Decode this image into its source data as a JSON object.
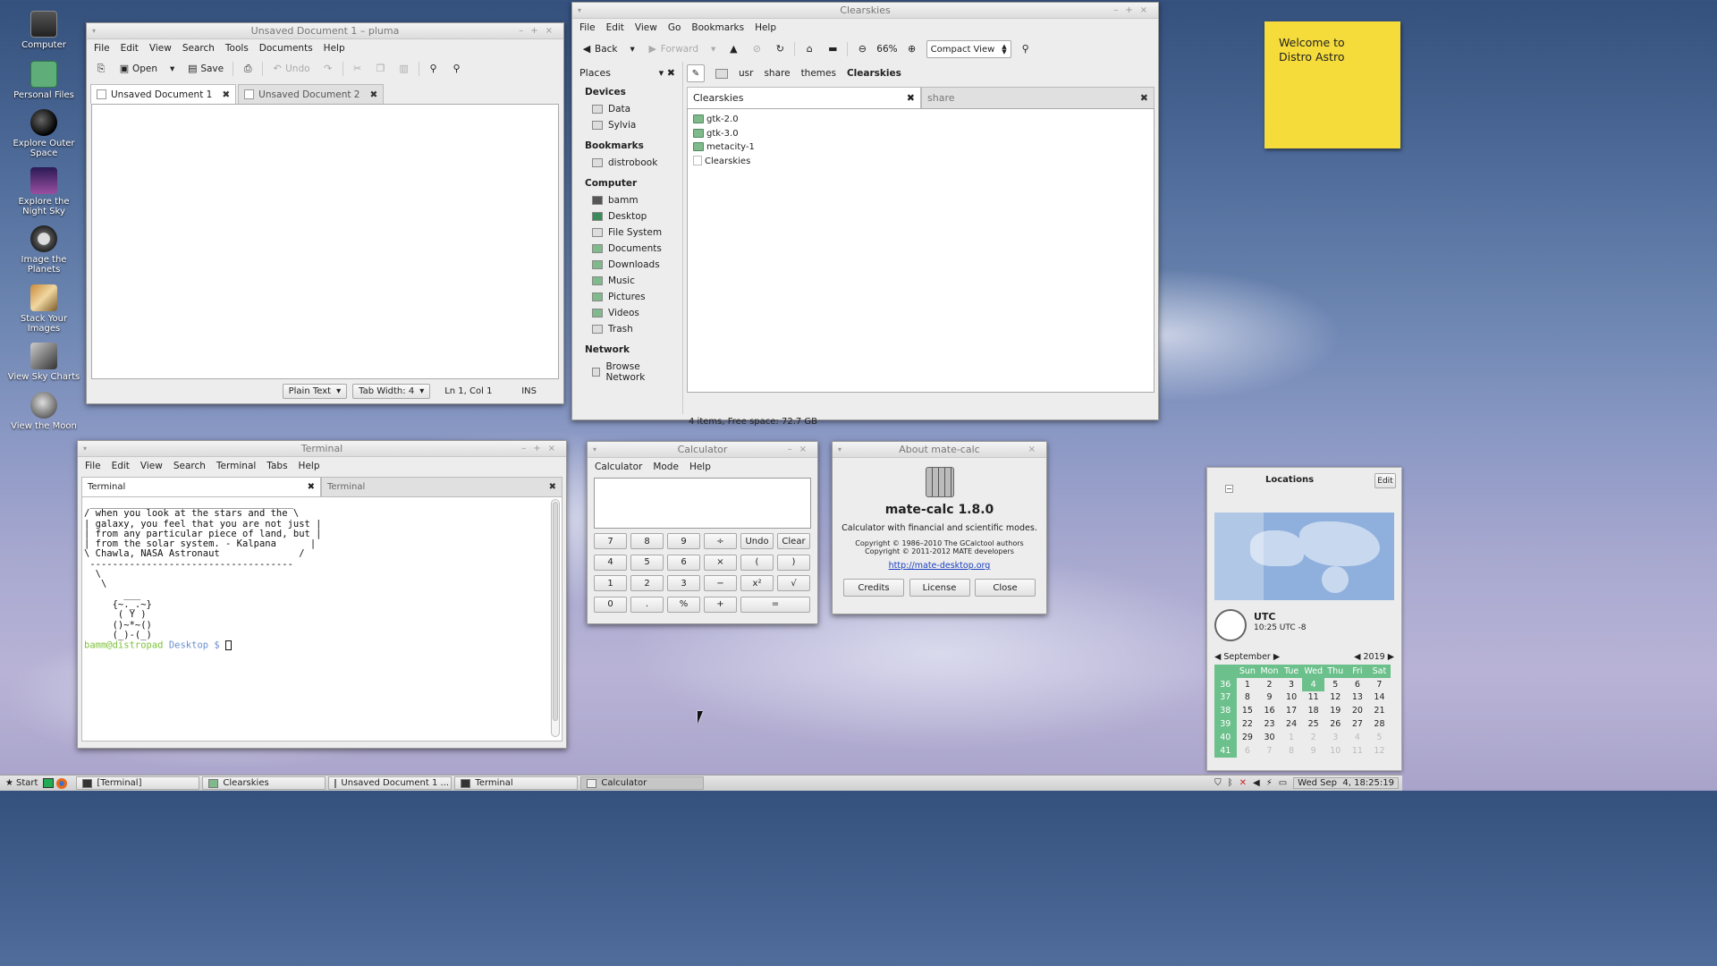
{
  "desktop_icons": [
    {
      "label": "Computer"
    },
    {
      "label": "Personal Files"
    },
    {
      "label": "Explore Outer Space"
    },
    {
      "label": "Explore the Night Sky"
    },
    {
      "label": "Image the Planets"
    },
    {
      "label": "Stack Your Images"
    },
    {
      "label": "View Sky Charts"
    },
    {
      "label": "View the Moon"
    }
  ],
  "sticky": {
    "text": "Welcome to Distro Astro"
  },
  "pluma": {
    "title": "Unsaved Document 1 – pluma",
    "menu": [
      "File",
      "Edit",
      "View",
      "Search",
      "Tools",
      "Documents",
      "Help"
    ],
    "toolbar": {
      "open": "Open",
      "save": "Save",
      "undo": "Undo"
    },
    "tabs": [
      "Unsaved Document 1",
      "Unsaved Document 2"
    ],
    "status": {
      "lang": "Plain Text",
      "tabwidth": "Tab Width:  4",
      "pos": "Ln 1, Col 1",
      "mode": "INS"
    }
  },
  "caja": {
    "title": "Clearskies",
    "menu": [
      "File",
      "Edit",
      "View",
      "Go",
      "Bookmarks",
      "Help"
    ],
    "toolbar": {
      "back": "Back",
      "forward": "Forward",
      "zoom": "66%",
      "view": "Compact View"
    },
    "places_label": "Places",
    "path": [
      "usr",
      "share",
      "themes",
      "Clearskies"
    ],
    "sections": [
      {
        "title": "Devices",
        "items": [
          "Data",
          "Sylvia"
        ]
      },
      {
        "title": "Bookmarks",
        "items": [
          "distrobook"
        ]
      },
      {
        "title": "Computer",
        "items": [
          "bamm",
          "Desktop",
          "File System",
          "Documents",
          "Downloads",
          "Music",
          "Pictures",
          "Videos",
          "Trash"
        ]
      },
      {
        "title": "Network",
        "items": [
          "Browse Network"
        ]
      }
    ],
    "tabs": [
      "Clearskies",
      "share"
    ],
    "files": [
      "gtk-2.0",
      "gtk-3.0",
      "metacity-1",
      "Clearskies"
    ],
    "status": "4 items, Free space: 72.7 GB"
  },
  "terminal": {
    "title": "Terminal",
    "menu": [
      "File",
      "Edit",
      "View",
      "Search",
      "Terminal",
      "Tabs",
      "Help"
    ],
    "tabs": [
      "Terminal",
      "Terminal"
    ],
    "lines": [
      " ____________________________________",
      "/ when you look at the stars and the \\",
      "| galaxy, you feel that you are not just |",
      "| from any particular piece of land, but |",
      "| from the solar system. - Kalpana      |",
      "\\ Chawla, NASA Astronaut              /",
      " ------------------------------------",
      "  \\",
      "   \\",
      "       ___",
      "     {~._.~}",
      "      ( Y )",
      "     ()~*~()",
      "     (_)-(_)"
    ],
    "prompt_user": "bamm@distropad",
    "prompt_dir": "Desktop $"
  },
  "calculator": {
    "title": "Calculator",
    "menu": [
      "Calculator",
      "Mode",
      "Help"
    ],
    "buttons": [
      [
        "7",
        "8",
        "9",
        "÷",
        "Undo",
        "Clear"
      ],
      [
        "4",
        "5",
        "6",
        "×",
        "(",
        ")"
      ],
      [
        "1",
        "2",
        "3",
        "−",
        "x²",
        "√"
      ],
      [
        "0",
        ".",
        "%",
        "+",
        "="
      ]
    ]
  },
  "about": {
    "title": "About mate-calc",
    "name": "mate-calc 1.8.0",
    "desc": "Calculator with financial and scientific modes.",
    "copy1": "Copyright © 1986–2010 The GCalctool authors",
    "copy2": "Copyright © 2011-2012 MATE developers",
    "link": "http://mate-desktop.org",
    "buttons": [
      "Credits",
      "License",
      "Close"
    ]
  },
  "clock": {
    "locations": "Locations",
    "edit": "Edit",
    "tz": "UTC",
    "time": "10:25 UTC -8",
    "month": "September",
    "year": "2019",
    "days": [
      "Sun",
      "Mon",
      "Tue",
      "Wed",
      "Thu",
      "Fri",
      "Sat"
    ],
    "weeks": [
      {
        "wk": "36",
        "d": [
          "1",
          "2",
          "3",
          "4",
          "5",
          "6",
          "7"
        ]
      },
      {
        "wk": "37",
        "d": [
          "8",
          "9",
          "10",
          "11",
          "12",
          "13",
          "14"
        ]
      },
      {
        "wk": "38",
        "d": [
          "15",
          "16",
          "17",
          "18",
          "19",
          "20",
          "21"
        ]
      },
      {
        "wk": "39",
        "d": [
          "22",
          "23",
          "24",
          "25",
          "26",
          "27",
          "28"
        ]
      },
      {
        "wk": "40",
        "d": [
          "29",
          "30",
          "1",
          "2",
          "3",
          "4",
          "5"
        ]
      },
      {
        "wk": "41",
        "d": [
          "6",
          "7",
          "8",
          "9",
          "10",
          "11",
          "12"
        ]
      }
    ]
  },
  "taskbar": {
    "start": "Start",
    "tasks": [
      "[Terminal]",
      "Clearskies",
      "Unsaved Document 1 ...",
      "Terminal",
      "Calculator"
    ],
    "datetime": "Wed Sep  4, 18:25:19"
  },
  "colors": {
    "accent": "#6cc08b",
    "sticky": "#f5dc3a"
  }
}
